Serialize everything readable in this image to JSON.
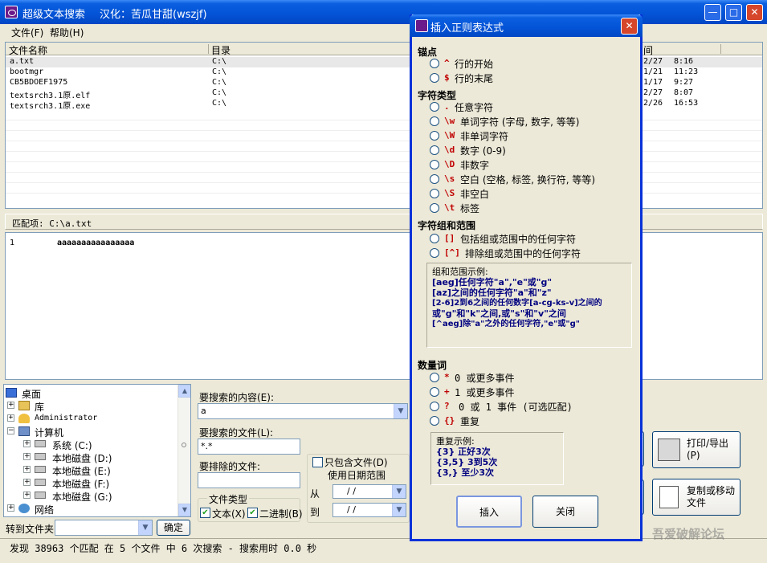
{
  "app": {
    "title": "超级文本搜索",
    "credit": "汉化：苦瓜甘甜(wszjf)",
    "min": "—",
    "max": "□",
    "close": "✕"
  },
  "menu": [
    "文件(F)",
    "帮助(H)"
  ],
  "filelist": {
    "columns": [
      "文件名称",
      "目录",
      "间"
    ],
    "rows": [
      {
        "name": "a.txt",
        "dir": "C:\\",
        "date": "2/27",
        "time": "8:16"
      },
      {
        "name": "bootmgr",
        "dir": "C:\\",
        "date": "1/21",
        "time": "11:23"
      },
      {
        "name": "CB5BDOEF1975",
        "dir": "C:\\",
        "date": "1/17",
        "time": "9:27"
      },
      {
        "name": "textsrch3.1原.elf",
        "dir": "C:\\",
        "date": "2/27",
        "time": "8:07"
      },
      {
        "name": "textsrch3.1原.exe",
        "dir": "C:\\",
        "date": "2/26",
        "time": "16:53"
      }
    ]
  },
  "match": {
    "label": "匹配项: C:\\a.txt",
    "line": "1",
    "text": "aaaaaaaaaaaaaaaa"
  },
  "tree": {
    "items": [
      {
        "label": "桌面",
        "exp": ""
      },
      {
        "label": "库",
        "exp": "+"
      },
      {
        "label": "Administrator",
        "exp": "+"
      },
      {
        "label": "计算机",
        "exp": "−"
      },
      {
        "label": "系统 (C:)",
        "exp": "+"
      },
      {
        "label": "本地磁盘 (D:)",
        "exp": "+"
      },
      {
        "label": "本地磁盘 (E:)",
        "exp": "+"
      },
      {
        "label": "本地磁盘 (F:)",
        "exp": "+"
      },
      {
        "label": "本地磁盘 (G:)",
        "exp": "+"
      },
      {
        "label": "网络",
        "exp": "+"
      }
    ]
  },
  "goto": {
    "label": "转到文件夹",
    "button": "确定",
    "value": ""
  },
  "search": {
    "content_label": "要搜索的内容(E):",
    "content_value": "a",
    "files_label": "要搜索的文件(L):",
    "files_value": "*.*",
    "exclude_label": "要排除的文件:",
    "exclude_value": "",
    "filetype_label": "文件类型",
    "text_label": "文本(X)",
    "binary_label": "二进制(B)",
    "only_files_label": "只包含文件(D)",
    "date_range_label": "使用日期范围",
    "from_label": "从",
    "to_label": "到",
    "from_value": "/  /",
    "to_value": "/  /"
  },
  "actions": {
    "print_label": "打印/导出(P)",
    "copy_label": "复制或移动文件"
  },
  "status": "发现 38963 个匹配 在 5 个文件 中 6 次搜索 - 搜索用时 0.0 秒",
  "watermark": "吾爱破解论坛",
  "dialog": {
    "title": "插入正则表达式",
    "anchor_title": "锚点",
    "anchors": [
      {
        "sym": "^",
        "text": "行的开始"
      },
      {
        "sym": "$",
        "text": "行的末尾"
      }
    ],
    "class_title": "字符类型",
    "classes": [
      {
        "sym": ".",
        "text": "任意字符"
      },
      {
        "sym": "\\w",
        "text": "单词字符 (字母, 数字, 等等)"
      },
      {
        "sym": "\\W",
        "text": "非单词字符"
      },
      {
        "sym": "\\d",
        "text": "数字 (0-9)"
      },
      {
        "sym": "\\D",
        "text": "非数字"
      },
      {
        "sym": "\\s",
        "text": "空白 (空格, 标签, 换行符, 等等)"
      },
      {
        "sym": "\\S",
        "text": "非空白"
      },
      {
        "sym": "\\t",
        "text": "标签"
      }
    ],
    "group_title": "字符组和范围",
    "groups": [
      {
        "sym": "[]",
        "text": "包括组或范围中的任何字符"
      },
      {
        "sym": "[^]",
        "text": "排除组或范围中的任何字符"
      }
    ],
    "group_example": {
      "title": "组和范围示例:",
      "lines": [
        "[aeg]任何字符\"a\",\"e\"或\"g\"",
        "[az]之间的任何字符\"a\"和\"z\"",
        "[2-6]2到6之间的任何数字[a-cg-ks-v]之间的",
        "或\"g\"和\"k\"之间,或\"s\"和\"v\"之间",
        "[^aeg]除\"a\"之外的任何字符,\"e\"或\"g\""
      ]
    },
    "quant_title": "数量词",
    "quantifiers": [
      {
        "sym": "*",
        "text": "0 或更多事件"
      },
      {
        "sym": "+",
        "text": "1 或更多事件"
      },
      {
        "sym": "?",
        "text": "0 或 1 事件 (可选匹配)"
      },
      {
        "sym": "{}",
        "text": "重复"
      }
    ],
    "repeat_example": {
      "title": "重复示例:",
      "lines": [
        "{3} 正好3次",
        "{3,5} 3到5次",
        "{3,} 至少3次"
      ]
    },
    "insert_button": "插入",
    "close_button": "关闭"
  }
}
